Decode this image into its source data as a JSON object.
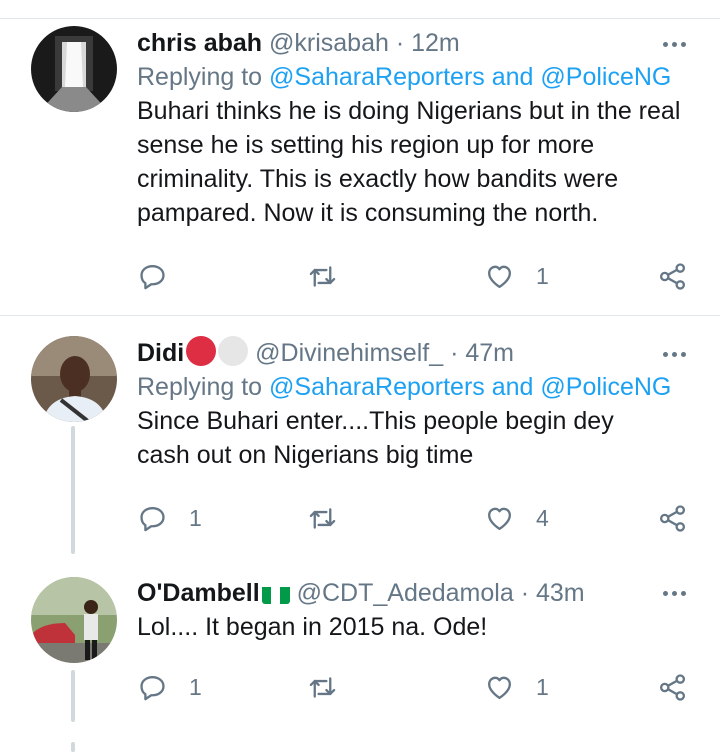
{
  "tweets": [
    {
      "display_name": "chris abah",
      "handle": "@krisabah",
      "time": "12m",
      "replying_prefix": "Replying to",
      "replying_targets": "@SaharaReporters and @PoliceNG",
      "text": "Buhari thinks he is doing Nigerians but in the real sense he is setting his region up for more criminality. This is exactly how bandits were pampared.  Now it is consuming the north.",
      "replies": "",
      "retweets": "",
      "likes": "1"
    },
    {
      "display_name": "Didi",
      "handle": "@Divinehimself_",
      "time": "47m",
      "replying_prefix": "Replying to",
      "replying_targets": "@SaharaReporters and @PoliceNG",
      "text": "Since Buhari enter....This people begin dey cash out on Nigerians big time",
      "replies": "1",
      "retweets": "",
      "likes": "4"
    },
    {
      "display_name": "O'Dambell",
      "handle": "@CDT_Adedamola",
      "time": "43m",
      "text": "Lol.... It began in 2015 na. Ode!",
      "replies": "1",
      "retweets": "",
      "likes": "1"
    }
  ],
  "colors": {
    "link": "#1da1f2",
    "secondary_text": "#657786",
    "divider": "#e1e8ed",
    "red_emoji": "#dd2e44",
    "flag_green": "#009a49"
  },
  "icons": [
    "more-icon",
    "reply-icon",
    "retweet-icon",
    "like-icon",
    "share-icon"
  ]
}
